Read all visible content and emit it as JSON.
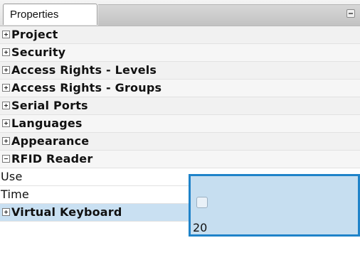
{
  "panel": {
    "tab_label": "Properties",
    "categories": [
      {
        "label": "Project",
        "expanded": false
      },
      {
        "label": "Security",
        "expanded": false
      },
      {
        "label": "Access Rights - Levels",
        "expanded": false
      },
      {
        "label": "Access Rights - Groups",
        "expanded": false
      },
      {
        "label": "Serial Ports",
        "expanded": false
      },
      {
        "label": "Languages",
        "expanded": false
      },
      {
        "label": "Appearance",
        "expanded": false
      },
      {
        "label": "RFID Reader",
        "expanded": true
      }
    ],
    "rfid_properties": [
      {
        "name": "Use",
        "value_type": "checkbox",
        "checked": false
      },
      {
        "name": "Time",
        "value_type": "text",
        "value": "20"
      }
    ],
    "trailing_category": {
      "label": "Virtual Keyboard",
      "expanded": false
    }
  },
  "colors": {
    "selection_border": "#1f83c9",
    "selection_fill": "#c6def0"
  }
}
